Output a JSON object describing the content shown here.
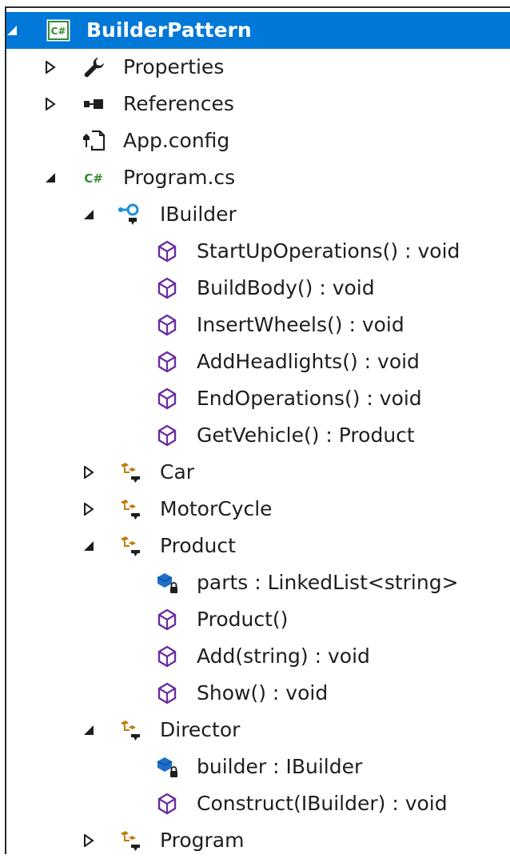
{
  "tree": {
    "project": {
      "label": "BuilderPattern",
      "icon": "csharp-project-icon",
      "expanded": true
    },
    "items": [
      {
        "label": "Properties",
        "icon": "wrench-icon",
        "expander": "collapsed"
      },
      {
        "label": "References",
        "icon": "references-icon",
        "expander": "collapsed"
      },
      {
        "label": "App.config",
        "icon": "config-file-icon",
        "expander": "none"
      },
      {
        "label": "Program.cs",
        "icon": "csharp-file-icon",
        "expander": "expanded"
      },
      {
        "label": "IBuilder",
        "icon": "interface-icon",
        "expander": "expanded"
      },
      {
        "label": "StartUpOperations() : void",
        "icon": "method-icon",
        "expander": "none"
      },
      {
        "label": "BuildBody() : void",
        "icon": "method-icon",
        "expander": "none"
      },
      {
        "label": "InsertWheels() : void",
        "icon": "method-icon",
        "expander": "none"
      },
      {
        "label": "AddHeadlights() : void",
        "icon": "method-icon",
        "expander": "none"
      },
      {
        "label": "EndOperations() : void",
        "icon": "method-icon",
        "expander": "none"
      },
      {
        "label": "GetVehicle() : Product",
        "icon": "method-icon",
        "expander": "none"
      },
      {
        "label": "Car",
        "icon": "class-icon",
        "expander": "collapsed"
      },
      {
        "label": "MotorCycle",
        "icon": "class-icon",
        "expander": "collapsed"
      },
      {
        "label": "Product",
        "icon": "class-icon",
        "expander": "expanded"
      },
      {
        "label": "parts : LinkedList<string>",
        "icon": "private-field-icon",
        "expander": "none"
      },
      {
        "label": "Product()",
        "icon": "method-icon",
        "expander": "none"
      },
      {
        "label": "Add(string) : void",
        "icon": "method-icon",
        "expander": "none"
      },
      {
        "label": "Show() : void",
        "icon": "method-icon",
        "expander": "none"
      },
      {
        "label": "Director",
        "icon": "class-icon",
        "expander": "expanded"
      },
      {
        "label": "builder : IBuilder",
        "icon": "private-field-icon",
        "expander": "none"
      },
      {
        "label": "Construct(IBuilder) : void",
        "icon": "method-icon",
        "expander": "none"
      },
      {
        "label": "Program",
        "icon": "class-icon",
        "expander": "collapsed"
      }
    ]
  },
  "colors": {
    "selection": "#0078d7",
    "method": "#6a2ca0",
    "class": "#c27c0e",
    "interface": "#1e8fd6",
    "field": "#1e6fc9",
    "csharp": "#388a34"
  }
}
